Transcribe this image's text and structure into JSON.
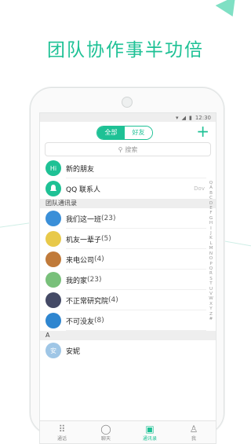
{
  "headline": "团队协作事半功倍",
  "status": {
    "time": "12:30"
  },
  "topbar": {
    "tab_all": "全部",
    "tab_friends": "好友",
    "add": "+"
  },
  "search": {
    "placeholder": "搜索"
  },
  "pinned": [
    {
      "name": "新的朋友",
      "avatar_text": "Hi",
      "color": "#1ec195"
    },
    {
      "name": "QQ 联系人",
      "avatar_text": "",
      "color": "#1ec195",
      "right": "Dov"
    }
  ],
  "team_section": "团队通讯录",
  "groups": [
    {
      "name": "我们这一班",
      "count": "(23)",
      "color": "#3a8fd8"
    },
    {
      "name": "机友一辈子",
      "count": "(5)",
      "color": "#e8c94a"
    },
    {
      "name": "来电公司",
      "count": "(4)",
      "color": "#c07a3a"
    },
    {
      "name": "我的家",
      "count": "(23)",
      "color": "#78c07a"
    },
    {
      "name": "不正常研究院",
      "count": "(4)",
      "color": "#444a66"
    },
    {
      "name": "不可没友",
      "count": "(8)",
      "color": "#2f86d0"
    }
  ],
  "letter_section": "A",
  "contacts": [
    {
      "name": "安妮",
      "avatar_text": "安",
      "color": "#9fc6e6"
    }
  ],
  "index_letters": [
    "Q",
    "A",
    "B",
    "C",
    "D",
    "E",
    "F",
    "G",
    "H",
    "I",
    "J",
    "K",
    "L",
    "M",
    "N",
    "O",
    "P",
    "Q",
    "R",
    "S",
    "T",
    "U",
    "V",
    "W",
    "X",
    "Y",
    "Z",
    "#"
  ],
  "tabs": [
    {
      "label": "通话",
      "icon": "dialpad-icon"
    },
    {
      "label": "聊天",
      "icon": "chat-icon"
    },
    {
      "label": "通讯录",
      "icon": "contacts-icon",
      "active": true
    },
    {
      "label": "我",
      "icon": "person-icon"
    }
  ]
}
